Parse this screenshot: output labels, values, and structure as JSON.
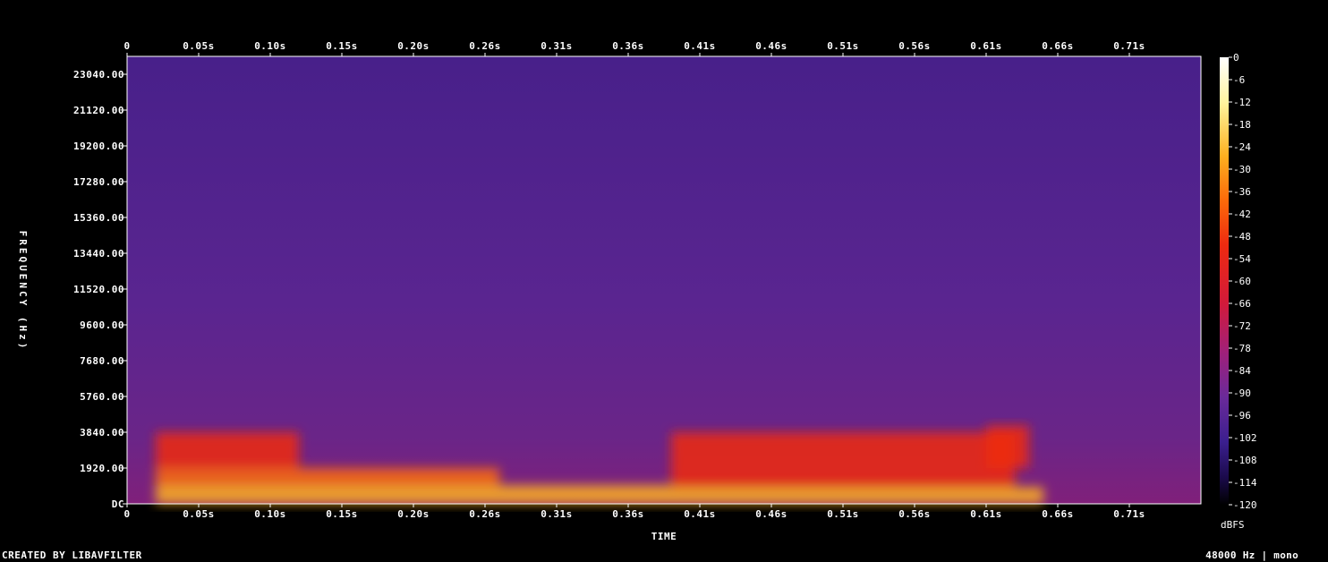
{
  "chart_data": {
    "type": "heatmap",
    "title": "",
    "xlabel": "TIME",
    "ylabel": "FREQUENCY (Hz)",
    "x_ticks": [
      "0",
      "0.05s",
      "0.10s",
      "0.15s",
      "0.20s",
      "0.26s",
      "0.31s",
      "0.36s",
      "0.41s",
      "0.46s",
      "0.51s",
      "0.56s",
      "0.61s",
      "0.66s",
      "0.71s"
    ],
    "y_ticks": [
      "DC",
      "1920.00",
      "3840.00",
      "5760.00",
      "7680.00",
      "9600.00",
      "11520.00",
      "13440.00",
      "15360.00",
      "17280.00",
      "19200.00",
      "21120.00",
      "23040.00"
    ],
    "xlim": [
      0,
      0.75
    ],
    "ylim": [
      0,
      24000
    ],
    "colorbar": {
      "unit": "dBFS",
      "ticks": [
        "0",
        "-6",
        "-12",
        "-18",
        "-24",
        "-30",
        "-36",
        "-42",
        "-48",
        "-54",
        "-60",
        "-66",
        "-72",
        "-78",
        "-84",
        "-90",
        "-96",
        "-102",
        "-108",
        "-114",
        "-120"
      ],
      "range": [
        -120,
        0
      ]
    },
    "colormap": [
      "#000000",
      "#1a0a4a",
      "#3b1f8f",
      "#6a2a9a",
      "#a0207a",
      "#d21a3a",
      "#ee2a10",
      "#fb6a0a",
      "#fdb020",
      "#fff5a0",
      "#ffffff"
    ],
    "energy_regions": [
      {
        "t0": 0.02,
        "t1": 0.38,
        "f0": 0,
        "f1": 1000,
        "level_db": -20
      },
      {
        "t0": 0.02,
        "t1": 0.26,
        "f0": 1000,
        "f1": 1920,
        "level_db": -40
      },
      {
        "t0": 0.02,
        "t1": 0.12,
        "f0": 1920,
        "f1": 3840,
        "level_db": -50
      },
      {
        "t0": 0.38,
        "t1": 0.64,
        "f0": 0,
        "f1": 900,
        "level_db": -22
      },
      {
        "t0": 0.38,
        "t1": 0.62,
        "f0": 900,
        "f1": 3840,
        "level_db": -52
      },
      {
        "t0": 0.6,
        "t1": 0.63,
        "f0": 1920,
        "f1": 4200,
        "level_db": -50
      }
    ]
  },
  "footer": {
    "credit": "CREATED BY LIBAVFILTER",
    "info": "48000 Hz | mono"
  }
}
